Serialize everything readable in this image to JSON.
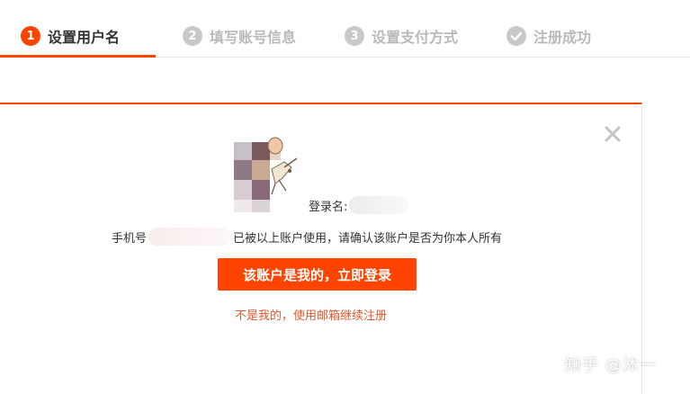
{
  "steps": [
    {
      "num": "1",
      "label": "设置用户名",
      "active": true
    },
    {
      "num": "2",
      "label": "填写账号信息",
      "active": false
    },
    {
      "num": "3",
      "label": "设置支付方式",
      "active": false
    },
    {
      "num": "",
      "label": "注册成功",
      "active": false,
      "icon": "check-circle-icon"
    }
  ],
  "dialog": {
    "close_icon": "close-icon",
    "avatar_icon": "user-avatar-pixelated",
    "login_label": "登录名:",
    "phone_prefix": "手机号",
    "phone_suffix": "已被以上账户使用，请确认该账户是否为你本人所有",
    "primary_button": "该账户是我的，立即登录",
    "alt_link": "不是我的，使用邮箱继续注册"
  },
  "watermark": "知乎 @沐一",
  "colors": {
    "accent": "#ff4400",
    "inactive_step": "#c8c8c8",
    "link": "#e4572a"
  }
}
